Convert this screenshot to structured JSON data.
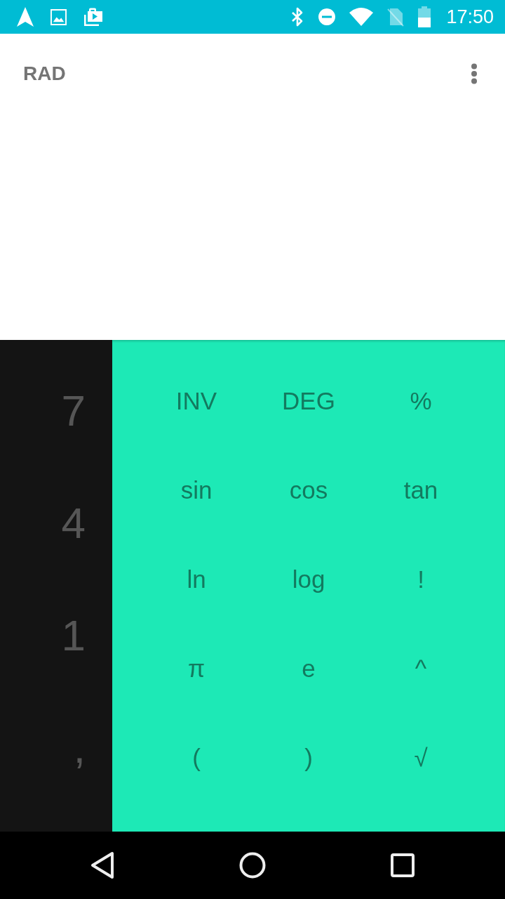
{
  "status_bar": {
    "time": "17:50"
  },
  "display": {
    "angle_mode": "RAD"
  },
  "number_pad": {
    "keys": [
      "7",
      "4",
      "1",
      ","
    ]
  },
  "advanced_pad": {
    "rows": [
      [
        "INV",
        "DEG",
        "%"
      ],
      [
        "sin",
        "cos",
        "tan"
      ],
      [
        "ln",
        "log",
        "!"
      ],
      [
        "π",
        "e",
        "^"
      ],
      [
        "(",
        ")",
        "√"
      ]
    ]
  }
}
